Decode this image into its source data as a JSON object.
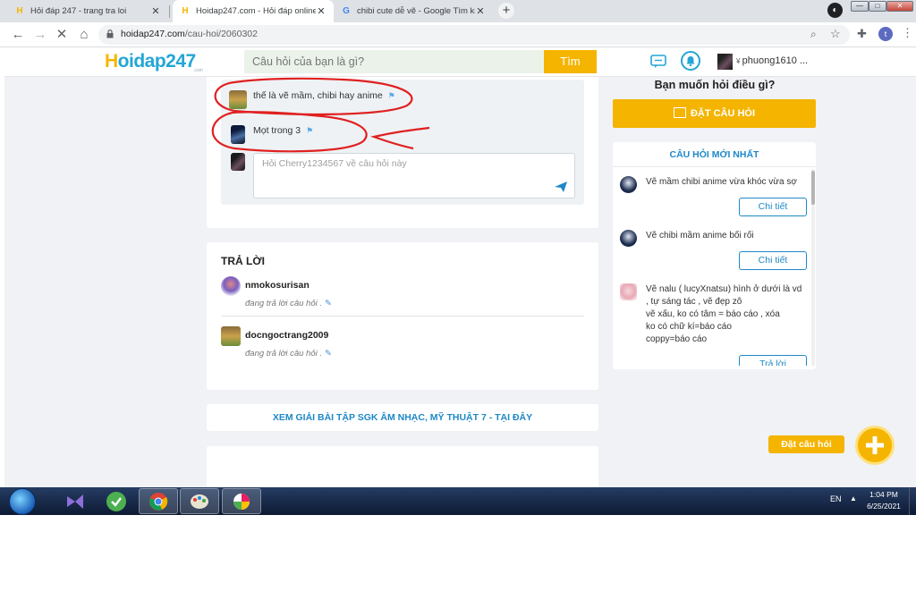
{
  "browser": {
    "tabs": [
      {
        "title": "Hỏi đáp 247 - trang tra loi",
        "favicon": "H",
        "active": false
      },
      {
        "title": "Hoidap247.com - Hỏi đáp online",
        "favicon": "H",
        "active": true
      },
      {
        "title": "chibi cute dễ vẽ - Google Tìm kiế",
        "favicon": "G",
        "active": false
      }
    ],
    "new_tab_label": "+",
    "url_host": "hoidap247.com",
    "url_path": "/cau-hoi/2060302",
    "profile_initial": "t"
  },
  "site": {
    "logo_h": "H",
    "logo_rest": "oidap247",
    "logo_sub": ".com",
    "search_placeholder": "Câu hỏi của bạn là gì?",
    "search_button": "Tìm",
    "username": "phuong1610 ..."
  },
  "comments": [
    {
      "text": "thế là vẽ mầm, chibi hay anime"
    },
    {
      "text": "Mọt trong 3"
    }
  ],
  "reply_placeholder": "Hỏi Cherry1234567 về câu hỏi này",
  "answers": {
    "title": "TRẢ LỜI",
    "items": [
      {
        "name": "nmokosurisan",
        "status": "đang trả lời câu hỏi ."
      },
      {
        "name": "docngoctrang2009",
        "status": "đang trả lời câu hỏi ."
      }
    ]
  },
  "sgk_link": "XEM GIẢI BÀI TẬP SGK ÂM NHẠC, MỸ THUẬT 7 - TẠI ĐÂY",
  "sidebar": {
    "ask_heading": "Bạn muốn hỏi điều gì?",
    "ask_button": "ĐẶT CÂU HỎI",
    "newest_title": "CÂU HỎI MỚI NHẤT",
    "questions": [
      {
        "text": "Vẽ mầm chibi anime vừa khóc vừa sợ",
        "button": "Chi tiết"
      },
      {
        "text": "Vẽ chibi mầm anime bối rối",
        "button": "Chi tiết"
      },
      {
        "text": "Vẽ nalu ( lucyXnatsu) hình ở dưới là vd\n, tự sáng tác , vẽ đẹp zô\nvẽ xấu, ko có tâm = báo cáo , xóa\nko có chữ kí=báo cáo\ncoppy=báo cáo",
        "button": "Trả lời"
      }
    ]
  },
  "fab": {
    "label": "Đặt câu hỏi"
  },
  "taskbar": {
    "lang": "EN",
    "tray_arrow": "▲",
    "time": "1:04 PM",
    "date": "6/25/2021"
  },
  "colors": {
    "brand_yellow": "#f4b400",
    "brand_blue": "#23a6d5",
    "link_blue": "#1e88c7",
    "annotation_red": "#e02020"
  }
}
